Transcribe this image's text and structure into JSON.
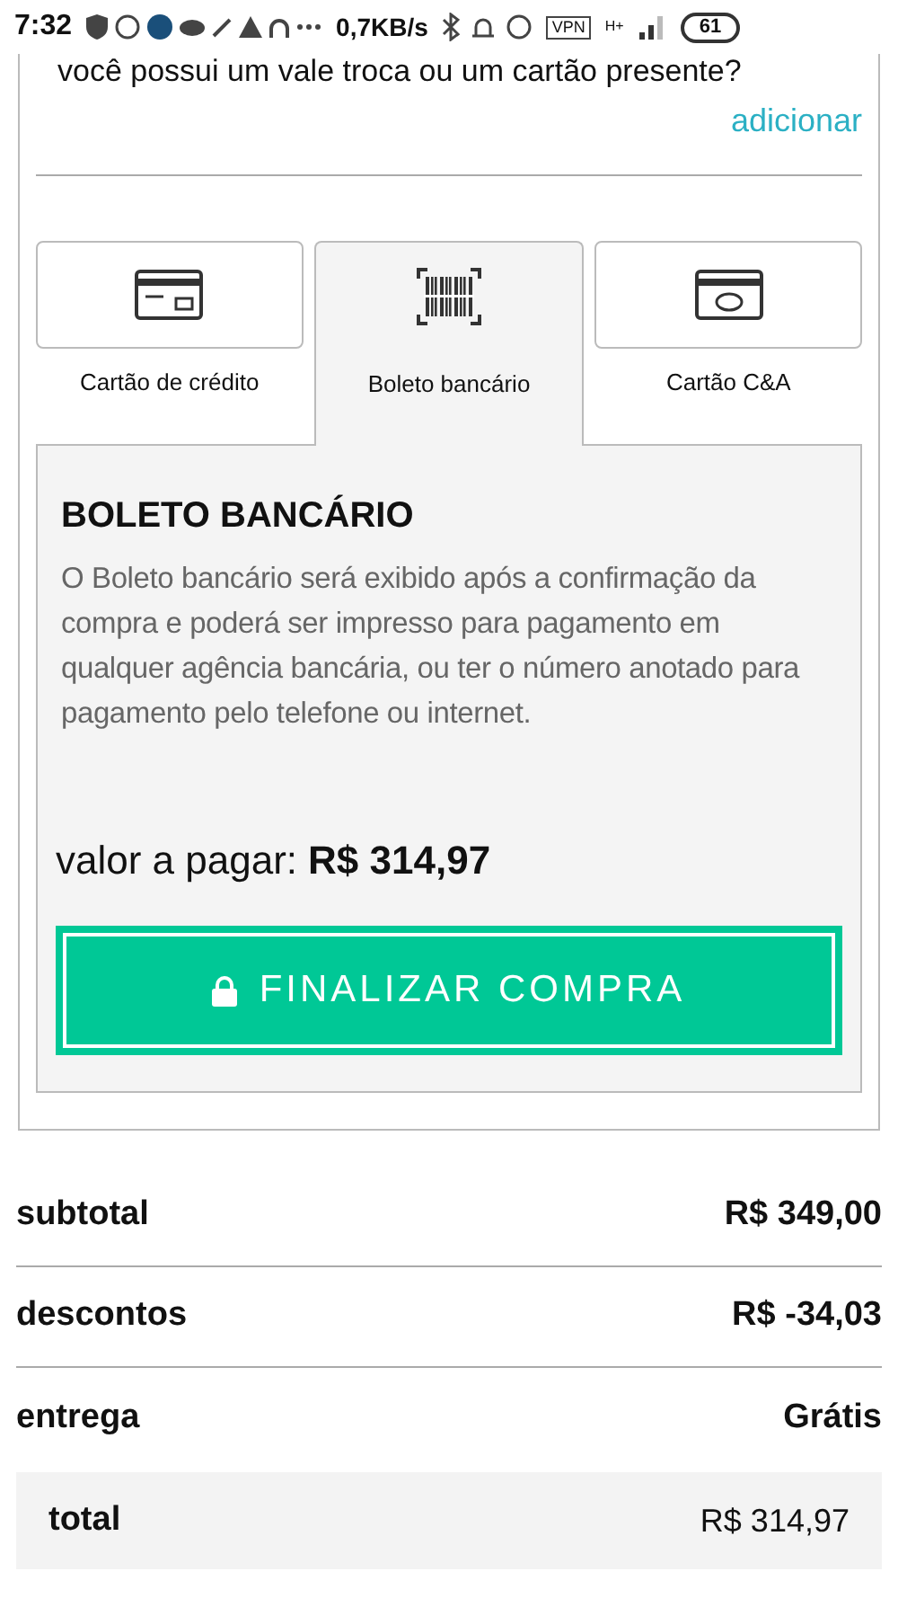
{
  "status_bar": {
    "time": "7:32",
    "speed": "0,7KB/s",
    "vpn": "VPN",
    "network": "H+",
    "battery": "61"
  },
  "gift": {
    "question": "você possui um vale troca ou um cartão presente?",
    "link": "adicionar"
  },
  "payment_tabs": [
    {
      "label": "Cartão de crédito",
      "kind": "card",
      "selected": false
    },
    {
      "label": "Boleto bancário",
      "kind": "barcode",
      "selected": true
    },
    {
      "label": "Cartão C&A",
      "kind": "store_card",
      "selected": false
    }
  ],
  "panel": {
    "title": "BOLETO BANCÁRIO",
    "description": "O Boleto bancário será exibido após a confirmação da compra e poderá ser impresso para pagamento em qualquer agência bancária, ou ter o número anotado para pagamento pelo telefone ou internet.",
    "amount_label": "valor a pagar:",
    "amount": "R$ 314,97",
    "button": "FINALIZAR COMPRA"
  },
  "summary": [
    {
      "label": "subtotal",
      "value": "R$ 349,00",
      "kind": "line"
    },
    {
      "label": "descontos",
      "value": "R$ -34,03",
      "kind": "line"
    },
    {
      "label": "entrega",
      "value": "Grátis",
      "kind": "line"
    },
    {
      "label": "total",
      "value": "R$ 314,97",
      "kind": "total"
    }
  ]
}
